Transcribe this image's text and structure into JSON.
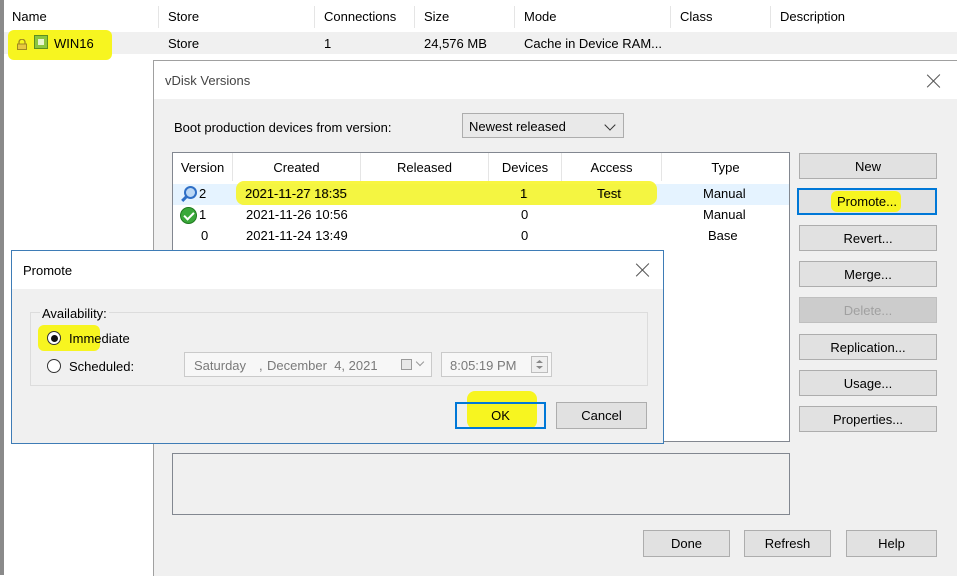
{
  "store_list": {
    "columns": [
      "Name",
      "Store",
      "Connections",
      "Size",
      "Mode",
      "Class",
      "Description"
    ],
    "row": {
      "name": "WIN16",
      "store": "Store",
      "connections": "1",
      "size": "24,576 MB",
      "mode": "Cache in Device RAM...",
      "class": "",
      "description": ""
    }
  },
  "vdisk_dialog": {
    "title": "vDisk Versions",
    "boot_label": "Boot production devices from version:",
    "boot_selected": "Newest released",
    "table": {
      "columns": [
        "Version",
        "Created",
        "Released",
        "Devices",
        "Access",
        "Type"
      ],
      "rows": [
        {
          "version": "2",
          "created": "2021-11-27 18:35",
          "released": "",
          "devices": "1",
          "access": "Test",
          "type": "Manual",
          "icon": "magnifier-icon"
        },
        {
          "version": "1",
          "created": "2021-11-26 10:56",
          "released": "",
          "devices": "0",
          "access": "",
          "type": "Manual",
          "icon": "check-icon"
        },
        {
          "version": "0",
          "created": "2021-11-24 13:49",
          "released": "",
          "devices": "0",
          "access": "",
          "type": "Base",
          "icon": ""
        }
      ]
    },
    "buttons": {
      "new": "New",
      "promote": "Promote...",
      "revert": "Revert...",
      "merge": "Merge...",
      "delete": "Delete...",
      "replication": "Replication...",
      "usage": "Usage...",
      "properties": "Properties...",
      "done": "Done",
      "refresh": "Refresh",
      "help": "Help"
    }
  },
  "promote_dialog": {
    "title": "Promote",
    "group_label": "Availability:",
    "immediate_label": "Immediate",
    "immediate_checked": true,
    "scheduled_label": "Scheduled:",
    "date": {
      "weekday": "Saturday",
      "sep": ",",
      "month_day": "December  4, 2021"
    },
    "time": "8:05:19 PM",
    "ok": "OK",
    "cancel": "Cancel"
  },
  "colors": {
    "highlight": "#f7f520",
    "accent": "#0078d7"
  }
}
